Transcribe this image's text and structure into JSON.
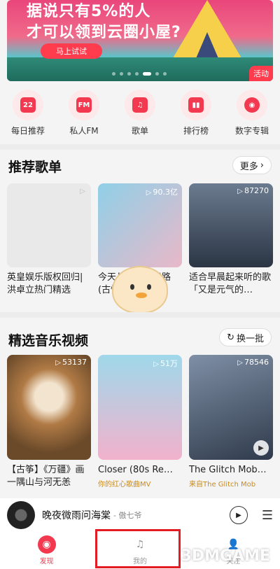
{
  "banner": {
    "line1": "据说只有5%的人",
    "line2": "才可以领到云圈小屋?",
    "cta": "马上试试",
    "tag": "活动"
  },
  "quick": [
    {
      "label": "每日推荐",
      "glyph": "22",
      "icon": "calendar-icon"
    },
    {
      "label": "私人FM",
      "glyph": "FM",
      "icon": "radio-icon"
    },
    {
      "label": "歌单",
      "glyph": "♫",
      "icon": "playlist-icon"
    },
    {
      "label": "排行榜",
      "glyph": "▮▮",
      "icon": "chart-icon"
    },
    {
      "label": "数字专辑",
      "glyph": "◉",
      "icon": "album-icon"
    }
  ],
  "playlists": {
    "title": "推荐歌单",
    "more": "更多",
    "items": [
      {
        "title": "英皇娱乐版权回归|洪卓立热门精选",
        "count": "",
        "bg": "#e9e9e9"
      },
      {
        "title": "今天从《仙人指路(古怪版)》听起|",
        "count": "90.3亿",
        "bg": "#b8d8e8"
      },
      {
        "title": "适合早晨起来听的歌「又是元气的…",
        "count": "87270",
        "bg": "#3c4a5e"
      }
    ]
  },
  "mvs": {
    "title": "精选音乐视频",
    "refresh": "换一批",
    "items": [
      {
        "title": "【古筝】《万疆》画一隅山与河无恙",
        "count": "53137",
        "sub": "",
        "bg": "#9b6b3c"
      },
      {
        "title": "Closer (80s Re…",
        "count": "51万",
        "sub": "你的红心歌曲MV",
        "bg": "#e8a6c0"
      },
      {
        "title": "The Glitch Mob…",
        "count": "78546",
        "sub": "来自The Glitch Mob",
        "bg": "#4a5a70"
      }
    ]
  },
  "player": {
    "song": "晚夜微雨问海棠",
    "artist": "- 傲七爷"
  },
  "nav": [
    {
      "label": "发现",
      "icon": "discover-icon",
      "active": true
    },
    {
      "label": "我的",
      "icon": "music-note-icon",
      "active": false
    },
    {
      "label": "关注",
      "icon": "follow-icon",
      "active": false
    }
  ],
  "watermark": "3DMGAME"
}
